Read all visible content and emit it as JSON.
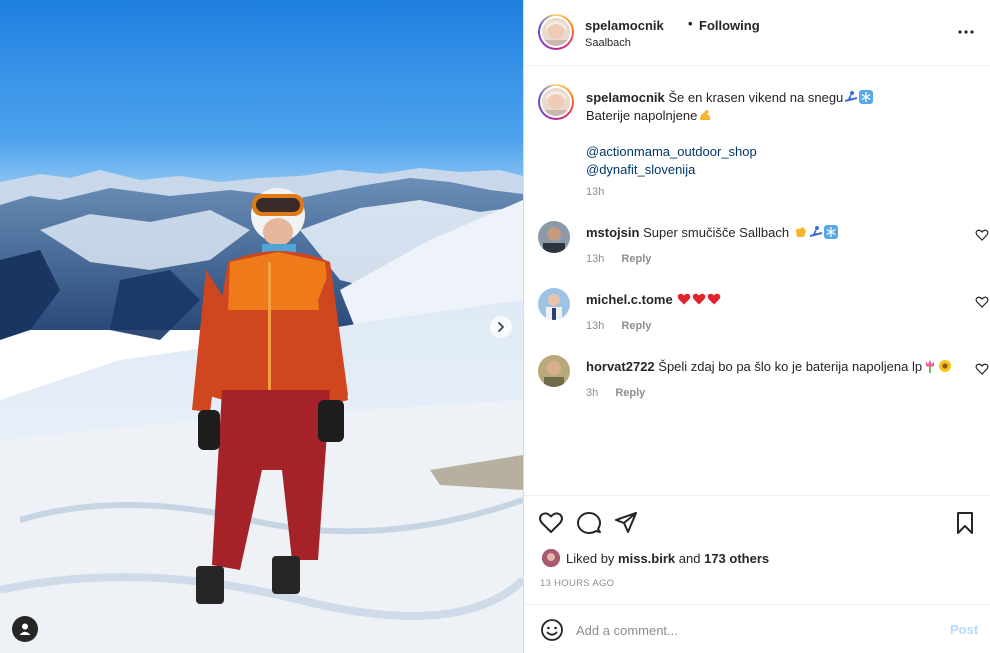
{
  "post": {
    "username": "spelamocnik",
    "separator": "•",
    "follow_state": "Following",
    "location": "Saalbach",
    "more_icon": "more-horizontal-icon"
  },
  "caption": {
    "username": "spelamocnik",
    "line1": "Še en krasen vikend na snegu",
    "line1_emojis": [
      "skier-icon",
      "snowflake-icon"
    ],
    "line2": "Baterije napolnjene",
    "line2_emojis": [
      "flexed-biceps-icon"
    ],
    "mention1": "@actionmama_outdoor_shop",
    "mention2": "@dynafit_slovenija",
    "time": "13h"
  },
  "comments": [
    {
      "username": "mstojsin",
      "text": "Super smučišče Sallbach",
      "emojis": [
        "clapping-icon",
        "skier-icon",
        "snowflake-icon"
      ],
      "time": "13h",
      "reply": "Reply"
    },
    {
      "username": "michel.c.tome",
      "text": "",
      "emojis": [
        "red-heart-icon",
        "red-heart-icon",
        "red-heart-icon"
      ],
      "time": "13h",
      "reply": "Reply"
    },
    {
      "username": "horvat2722",
      "text": "Špeli zdaj bo pa šlo ko je baterija napoljena lp",
      "emojis": [
        "tulip-icon",
        "sunflower-icon"
      ],
      "time": "3h",
      "reply": "Reply"
    }
  ],
  "likes": {
    "prefix": "Liked by",
    "user": "miss.birk",
    "middle": "and",
    "others": "173 others"
  },
  "timestamp": "13 HOURS AGO",
  "composer": {
    "placeholder": "Add a comment...",
    "post_label": "Post"
  },
  "colors": {
    "link": "#00376b",
    "muted": "#8e8e8e",
    "post_disabled": "#b3dbff",
    "heart": "#ed4956"
  }
}
